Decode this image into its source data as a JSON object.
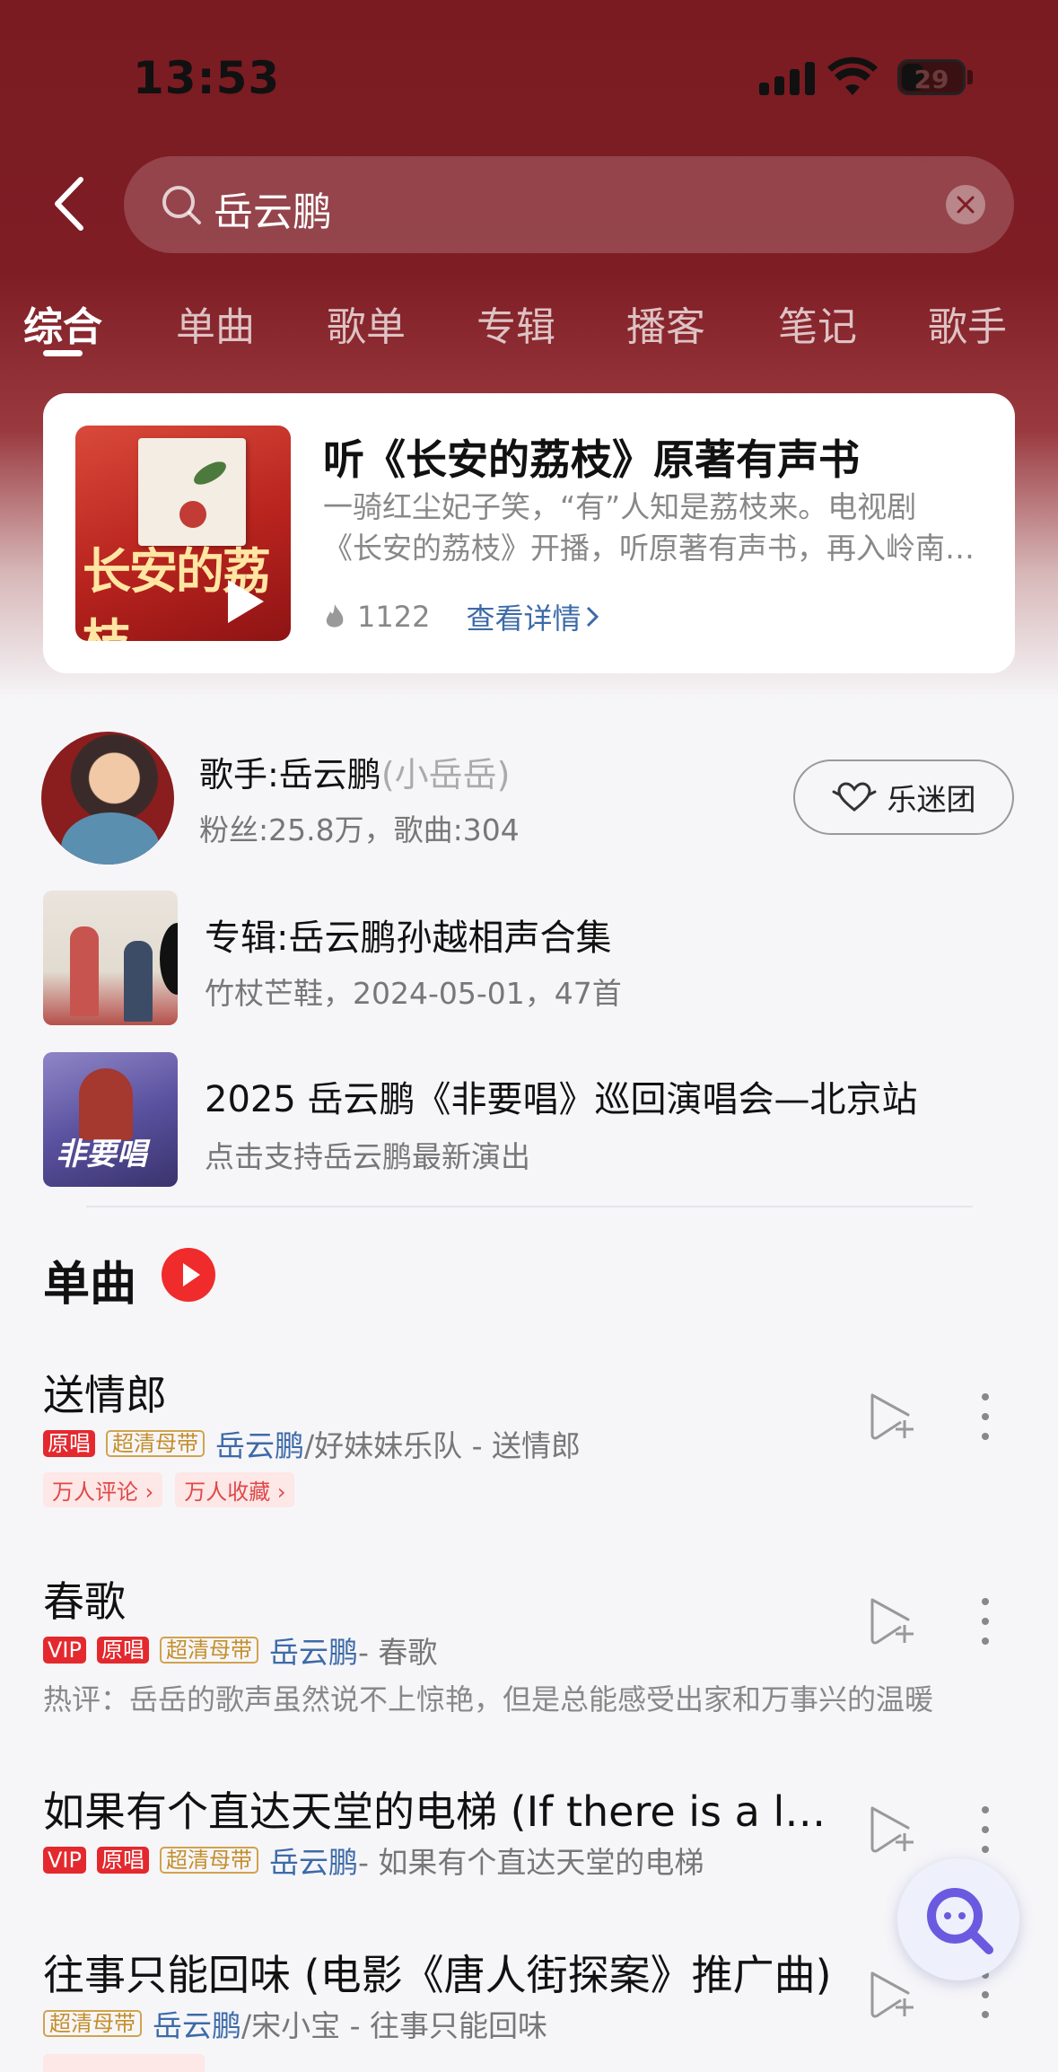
{
  "status_bar": {
    "time": "13:53",
    "battery": "29"
  },
  "search": {
    "query": "岳云鹏"
  },
  "tabs": [
    {
      "label": "综合",
      "active": true
    },
    {
      "label": "单曲"
    },
    {
      "label": "歌单"
    },
    {
      "label": "专辑"
    },
    {
      "label": "播客"
    },
    {
      "label": "笔记"
    },
    {
      "label": "歌手"
    }
  ],
  "banner": {
    "cover_text": "长安的荔枝",
    "title": "听《长安的荔枝》原著有声书",
    "desc_line1": "一骑红尘妃子笑，“有”人知是荔枝来。电视剧",
    "desc_line2": "《长安的荔枝》开播，听原著有声书，再入岭南看荔枝",
    "heat": "1122",
    "detail_link": "查看详情"
  },
  "artist": {
    "name": "歌手:岳云鹏",
    "alias": "(小岳岳)",
    "stats": "粉丝:25.8万，歌曲:304",
    "fan_button": "乐迷团"
  },
  "album": {
    "title": "专辑:岳云鹏孙越相声合集",
    "subtitle": "竹杖芒鞋，2024-05-01，47首"
  },
  "concert": {
    "title": "2025 岳云鹏《非要唱》巡回演唱会—北京站",
    "subtitle": "点击支持岳云鹏最新演出",
    "cover_text": "非要唱"
  },
  "section": {
    "title": "单曲"
  },
  "songs": [
    {
      "title": "送情郎",
      "badges": [
        "原唱",
        "超清母带"
      ],
      "artist": "岳云鹏",
      "rest": "/好妹妹乐队 - 送情郎",
      "chips": [
        "万人评论 ›",
        "万人收藏 ›"
      ]
    },
    {
      "title": "春歌",
      "badges": [
        "VIP",
        "原唱",
        "超清母带"
      ],
      "artist": "岳云鹏",
      "rest": " - 春歌",
      "comment": "热评：岳岳的歌声虽然说不上惊艳，但是总能感受出家和万事兴的温暖"
    },
    {
      "title": "如果有个直达天堂的电梯 (If there is a lift to heaven)",
      "badges": [
        "VIP",
        "原唱",
        "超清母带"
      ],
      "artist": "岳云鹏",
      "rest": " - 如果有个直达天堂的电梯"
    },
    {
      "title": "往事只能回味 (电影《唐人街探案》推广曲)",
      "badges": [
        "超清母带"
      ],
      "artist": "岳云鹏",
      "rest": "/宋小宝 - 往事只能回味"
    }
  ],
  "colors": {
    "accent": "#e4292e",
    "link": "#3d6aa8",
    "header_bg": "#7e1d24"
  }
}
